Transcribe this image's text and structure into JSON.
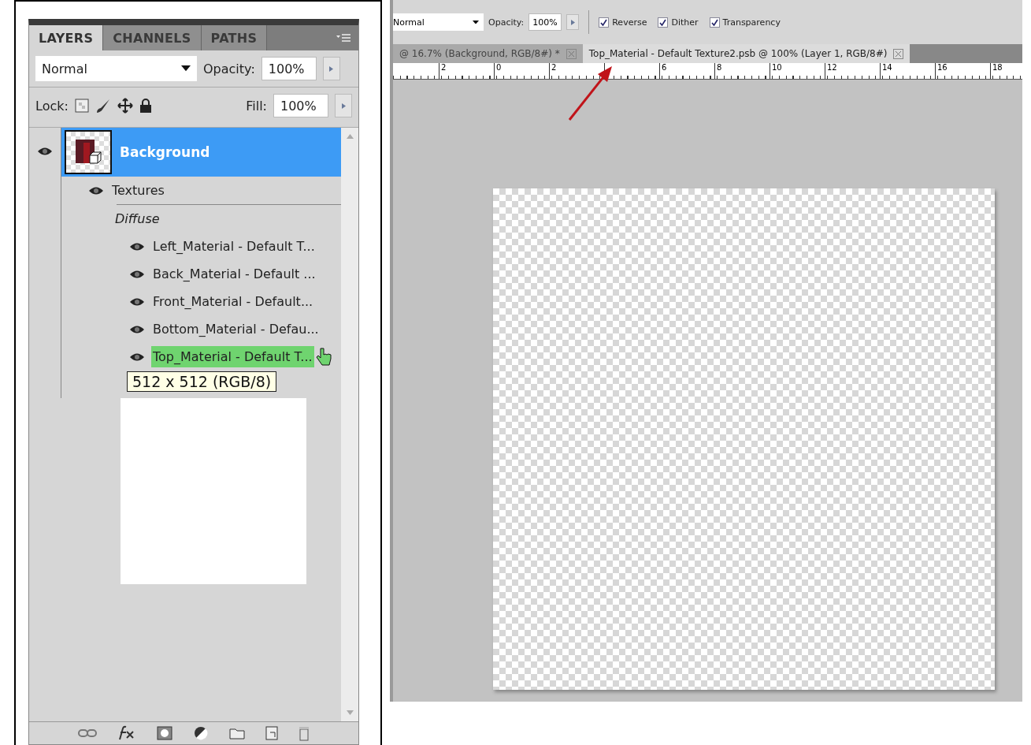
{
  "layers_panel": {
    "tabs": [
      {
        "label": "LAYERS",
        "selected": true
      },
      {
        "label": "CHANNELS",
        "selected": false
      },
      {
        "label": "PATHS",
        "selected": false
      }
    ],
    "blend_mode": "Normal",
    "opacity_label": "Opacity:",
    "opacity": "100%",
    "lock_label": "Lock:",
    "fill_label": "Fill:",
    "fill": "100%",
    "layer": {
      "name": "Background",
      "selected": true
    },
    "effects": {
      "name": "Textures",
      "group": "Diffuse",
      "items": [
        {
          "kind": "row",
          "name": "Left_Material - Default T...",
          "selected": false
        },
        {
          "kind": "row",
          "name": "Back_Material - Default ...",
          "selected": false
        },
        {
          "kind": "row",
          "name": "Front_Material - Default...",
          "selected": false
        },
        {
          "kind": "row",
          "name": "Bottom_Material - Defau...",
          "selected": false
        },
        {
          "kind": "row",
          "name": "Top_Material - Default T...",
          "selected": true
        },
        {
          "kind": "covered"
        }
      ]
    },
    "tooltip": "512 x 512 (RGB/8)"
  },
  "options_bar": {
    "blend_mode": "Normal",
    "opacity_label": "Opacity:",
    "opacity": "100%",
    "checkboxes": [
      {
        "label": "Reverse",
        "checked": true
      },
      {
        "label": "Dither",
        "checked": true
      },
      {
        "label": "Transparency",
        "checked": true
      }
    ]
  },
  "document_tabs": [
    {
      "label": "@ 16.7% (Background, RGB/8#) *",
      "selected": false
    },
    {
      "label": "Top_Material - Default Texture2.psb @ 100% (Layer 1, RGB/8#)",
      "selected": true
    }
  ],
  "ruler": {
    "ticks": [
      {
        "kind": "labeled",
        "label": "2"
      },
      {
        "kind": "labeled",
        "label": "0"
      },
      {
        "kind": "labeled",
        "label": "2"
      },
      {
        "kind": "covered"
      },
      {
        "kind": "labeled",
        "label": "6"
      },
      {
        "kind": "labeled",
        "label": "8"
      },
      {
        "kind": "labeled",
        "label": "10"
      },
      {
        "kind": "labeled",
        "label": "12"
      },
      {
        "kind": "labeled",
        "label": "14"
      },
      {
        "kind": "labeled",
        "label": "16"
      },
      {
        "kind": "labeled",
        "label": "18"
      }
    ]
  }
}
